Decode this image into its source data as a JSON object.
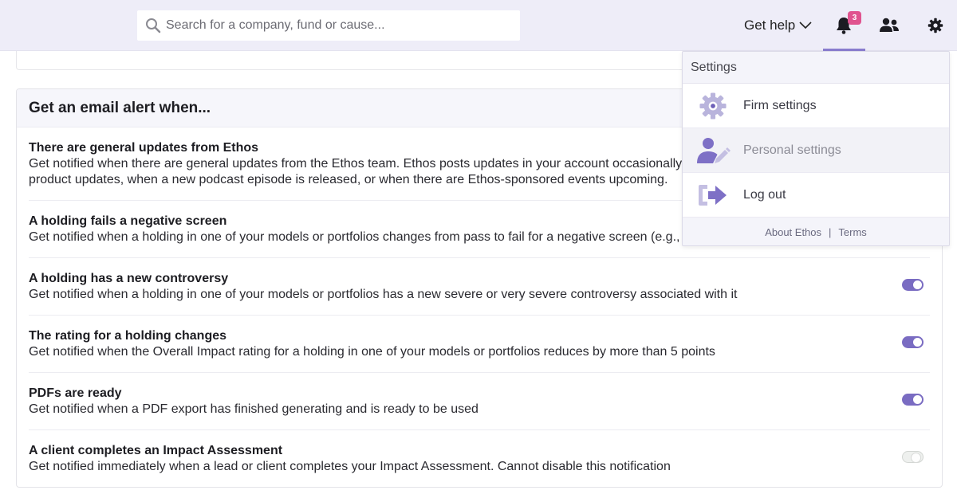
{
  "header": {
    "search_placeholder": "Search for a company, fund or cause...",
    "get_help_label": "Get help",
    "notification_count": "3"
  },
  "alerts": {
    "title": "Get an email alert when...",
    "items": [
      {
        "title": "There are general updates from Ethos",
        "desc_line1": "Get notified when there are general updates from the Ethos team. Ethos posts updates in your account occasionally, for ex",
        "desc_line2": "product updates, when a new podcast episode is released, or when there are Ethos-sponsored events upcoming.",
        "enabled": true
      },
      {
        "title": "A holding fails a negative screen",
        "desc_line1": "Get notified when a holding in one of your models or portfolios changes from pass to fail for a negative screen (e.g., fossil fu",
        "enabled": true
      },
      {
        "title": "A holding has a new controversy",
        "desc_line1": "Get notified when a holding in one of your models or portfolios has a new severe or very severe controversy associated with it",
        "enabled": true
      },
      {
        "title": "The rating for a holding changes",
        "desc_line1": "Get notified when the Overall Impact rating for a holding in one of your models or portfolios reduces by more than 5 points",
        "enabled": true
      },
      {
        "title": "PDFs are ready",
        "desc_line1": "Get notified when a PDF export has finished generating and is ready to be used",
        "enabled": true
      },
      {
        "title": "A client completes an Impact Assessment",
        "desc_line1": "Get notified immediately when a lead or client completes your Impact Assessment. Cannot disable this notification",
        "enabled": false
      }
    ]
  },
  "menu": {
    "heading": "Settings",
    "items": [
      {
        "label": "Firm settings",
        "icon": "gear-icon"
      },
      {
        "label": "Personal settings",
        "icon": "user-edit-icon"
      },
      {
        "label": "Log out",
        "icon": "logout-icon"
      }
    ],
    "footer": {
      "about": "About Ethos",
      "separator": "|",
      "terms": "Terms"
    }
  },
  "colors": {
    "header_bg": "#eeedf8",
    "accent": "#7a6cc2",
    "badge": "#e0538f"
  }
}
